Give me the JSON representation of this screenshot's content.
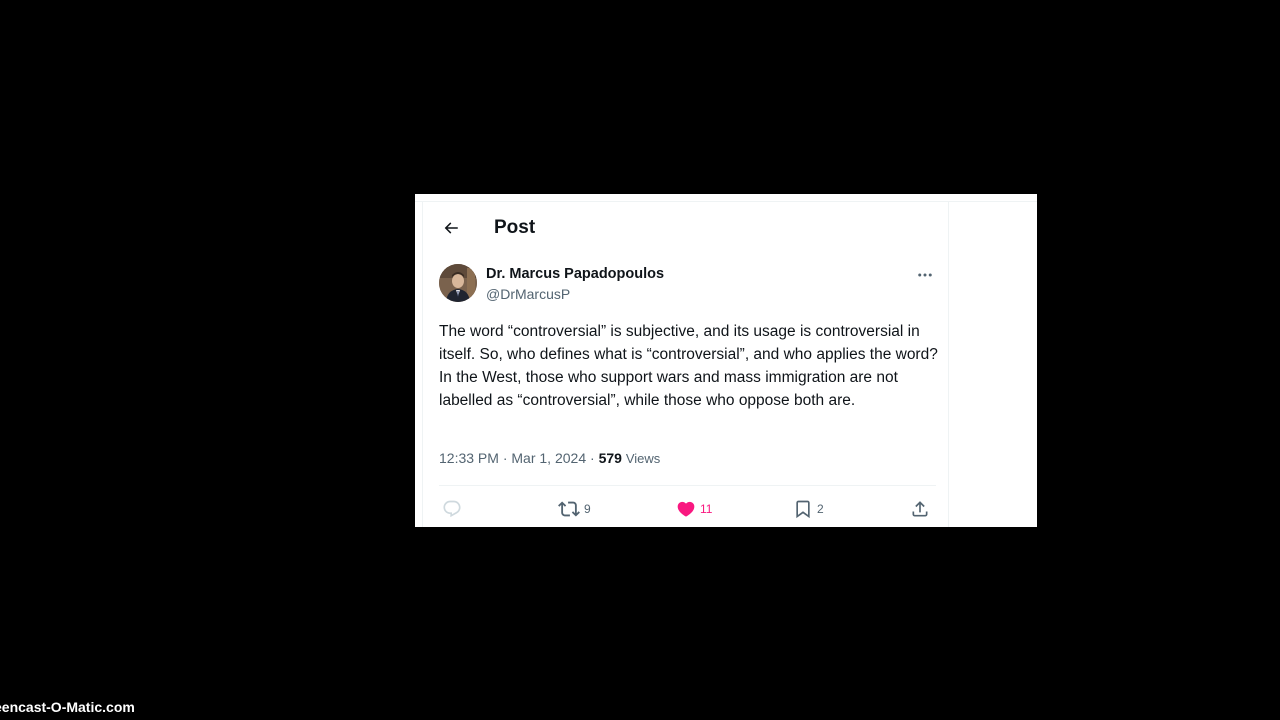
{
  "header": {
    "title": "Post"
  },
  "post": {
    "author_name": "Dr. Marcus Papadopoulos",
    "author_handle": "@DrMarcusP",
    "text": "The word “controversial” is subjective, and its usage is controversial in itself. So, who defines what is “controversial”, and who applies the word? In the West, those who support wars and mass immigration are not labelled as “controversial”, while those who oppose both are.",
    "time": "12:33 PM",
    "separator": " · ",
    "date": "Mar 1, 2024",
    "views_count": "579",
    "views_label": "Views"
  },
  "actions": {
    "reply_count": "",
    "repost_count": "9",
    "like_count": "11",
    "bookmark_count": "2"
  },
  "icons": {
    "back": "arrow-left-icon",
    "more": "more-horizontal-icon",
    "reply": "reply-icon",
    "repost": "repost-icon",
    "like": "heart-filled-icon",
    "bookmark": "bookmark-icon",
    "share": "share-icon"
  },
  "colors": {
    "text_primary": "#0f1419",
    "text_secondary": "#536471",
    "like_pink": "#f91880",
    "background": "#000000"
  },
  "watermark": {
    "text": "eencast-O-Matic.com"
  }
}
